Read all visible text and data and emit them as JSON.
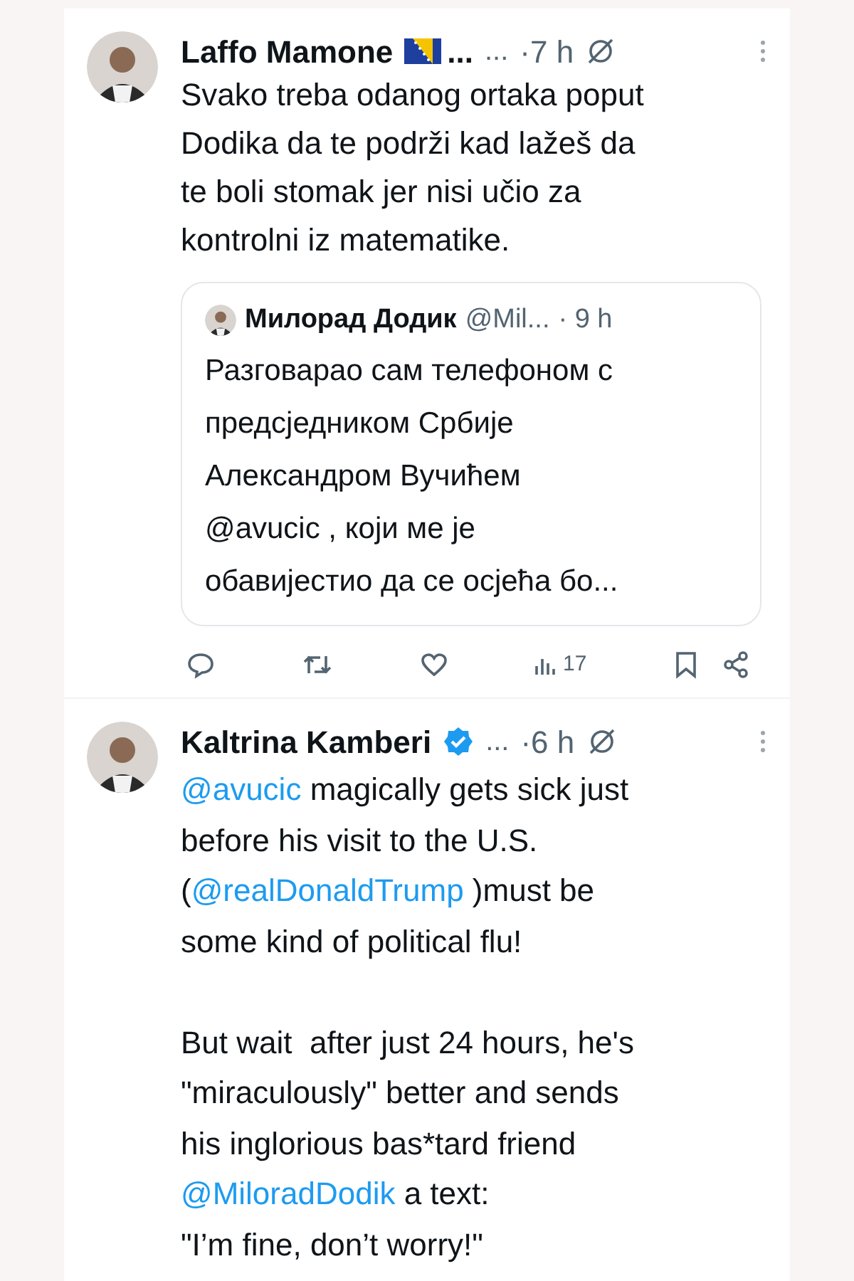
{
  "posts": [
    {
      "author": {
        "name": "Laffo Mamone",
        "name_cut": "...",
        "verified": false,
        "flag": true
      },
      "handle": "...",
      "time": "·7 h",
      "body": [
        {
          "kind": "text",
          "text": "Svako treba odanog ortaka poput\nDodika da te podrži kad lažeš da\nte boli stomak jer nisi učio za\nkontrolni iz matematike."
        }
      ],
      "quote": {
        "author": "Милорад Додик",
        "handle": "@Mil...",
        "time": "· 9 h",
        "body": "Разговарао сам телефоном с\nпредсједником Србије\nАлександром Вучићем\n@avucic , који ме је\nобавијестио да се осјећа бо..."
      },
      "actions": {
        "views": "17"
      }
    },
    {
      "author": {
        "name": "Kaltrina Kamberi",
        "verified": true,
        "flag": false
      },
      "handle": "...",
      "time": "·6 h",
      "body": [
        {
          "kind": "mention",
          "text": "@avucic"
        },
        {
          "kind": "text",
          "text": " magically gets sick just\nbefore his visit to the U.S.\n("
        },
        {
          "kind": "mention",
          "text": "@realDonaldTrump"
        },
        {
          "kind": "text",
          "text": " )must be\nsome kind of political flu!\n\nBut wait  after just 24 hours, he's\n\"miraculously\" better and sends\nhis inglorious bas*tard friend\n"
        },
        {
          "kind": "mention",
          "text": "@MiloradDodik"
        },
        {
          "kind": "text",
          "text": " a text:\n\"I’m fine, don’t worry!\""
        }
      ]
    }
  ]
}
